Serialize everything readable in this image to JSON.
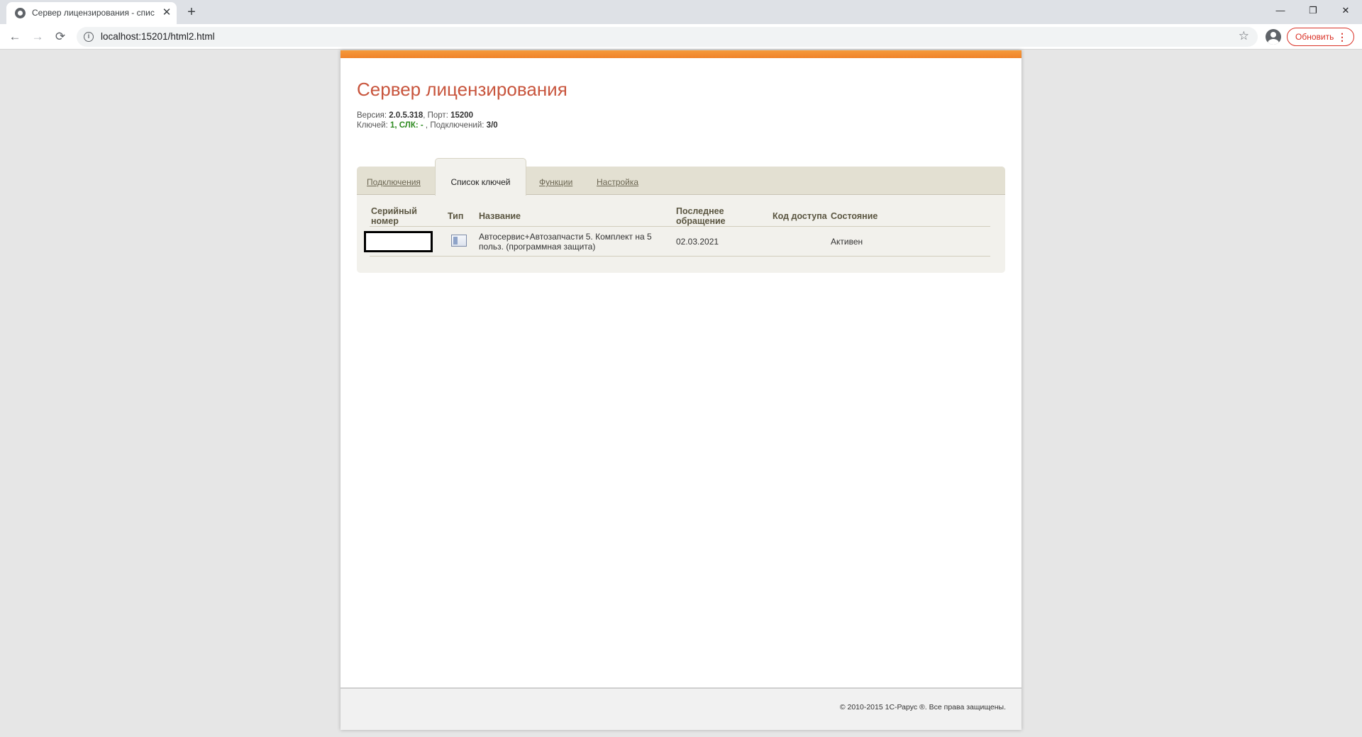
{
  "browser": {
    "tab_title": "Сервер лицензирования - спис",
    "url": "localhost:15201/html2.html",
    "update_label": "Обновить",
    "window_controls": {
      "minimize": "—",
      "restore": "❐",
      "close": "✕"
    }
  },
  "header": {
    "title": "Сервер лицензирования",
    "version_label": "Версия: ",
    "version": "2.0.5.318",
    "port_label": ", Порт: ",
    "port": "15200",
    "keys_label": "Ключей: ",
    "keys_value": "1, СЛК: -",
    "connections_label": " , Подключений: ",
    "connections_value": "3/0"
  },
  "tabs": [
    {
      "label": "Подключения",
      "active": false
    },
    {
      "label": "Список ключей",
      "active": true
    },
    {
      "label": "Функции",
      "active": false
    },
    {
      "label": "Настройка",
      "active": false
    }
  ],
  "table": {
    "columns": [
      "Серийный номер",
      "Тип",
      "Название",
      "Последнее обращение",
      "Код доступа",
      "Состояние"
    ],
    "rows": [
      {
        "serial": "",
        "type_icon": "software-key-icon",
        "name": "Автосервис+Автозапчасти 5. Комплект на 5 польз. (программная защита)",
        "last_access": "02.03.2021",
        "access_code": "",
        "status": "Активен"
      }
    ]
  },
  "footer": {
    "copyright": "© 2010-2015 1С-Рарус ®. Все права защищены."
  },
  "colors": {
    "title": "#c8553d",
    "accent_bar": "#f0822a",
    "status_active": "#4aa13a"
  }
}
